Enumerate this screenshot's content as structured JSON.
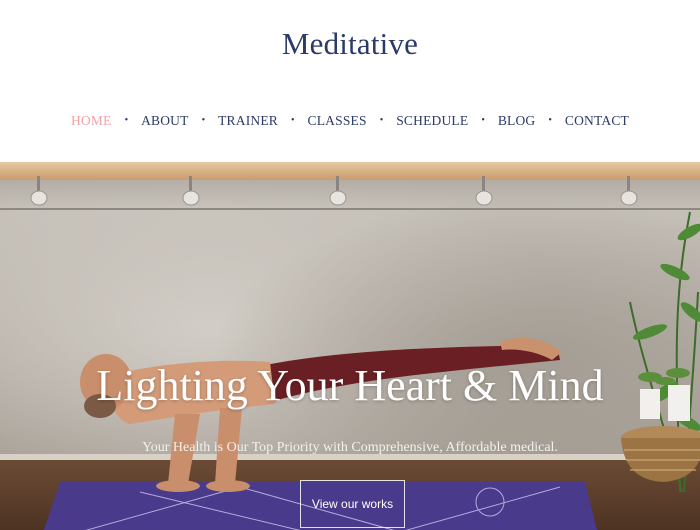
{
  "brand": {
    "name": "Meditative"
  },
  "nav": {
    "items": [
      {
        "label": "HOME",
        "active": true
      },
      {
        "label": "ABOUT",
        "active": false
      },
      {
        "label": "TRAINER",
        "active": false
      },
      {
        "label": "CLASSES",
        "active": false
      },
      {
        "label": "SCHEDULE",
        "active": false
      },
      {
        "label": "BLOG",
        "active": false
      },
      {
        "label": "CONTACT",
        "active": false
      }
    ]
  },
  "hero": {
    "title": "Lighting Your Heart & Mind",
    "subtitle": "Your Health is Our Top Priority with Comprehensive, Affordable medical.",
    "cta_label": "View our works"
  },
  "colors": {
    "brand": "#2b3a67",
    "active_nav": "#f0a3a8"
  }
}
